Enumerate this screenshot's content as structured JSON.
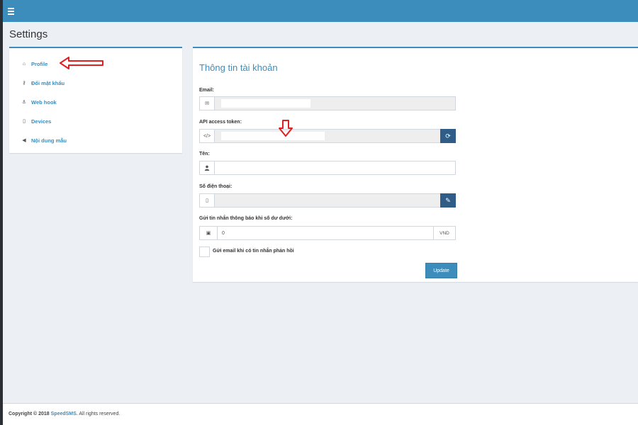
{
  "page": {
    "title": "Settings"
  },
  "sidebar": {
    "items": [
      {
        "label": "Profile",
        "icon": "home-icon",
        "glyph": "⌂"
      },
      {
        "label": "Đổi mật khẩu",
        "icon": "key-icon",
        "glyph": "⚷"
      },
      {
        "label": "Web hook",
        "icon": "anchor-icon",
        "glyph": "⚓"
      },
      {
        "label": "Devices",
        "icon": "mobile-icon",
        "glyph": "▯"
      },
      {
        "label": "Nội dung mẫu",
        "icon": "bullhorn-icon",
        "glyph": "◀"
      }
    ]
  },
  "form": {
    "title": "Thông tin tài khoản",
    "email_label": "Email:",
    "email_icon": "envelope-icon",
    "email_glyph": "✉",
    "token_label": "API access token:",
    "token_icon": "code-icon",
    "token_glyph": "</>",
    "token_refresh_icon": "refresh-icon",
    "token_refresh_glyph": "⟳",
    "name_label": "Tên:",
    "name_icon": "user-icon",
    "name_glyph": "👤",
    "phone_label": "Số điện thoại:",
    "phone_icon": "mobile-icon",
    "phone_glyph": "▯",
    "phone_edit_icon": "pencil-icon",
    "phone_edit_glyph": "✎",
    "balance_label": "Gửi tin nhắn thông báo khi số dư dưới:",
    "balance_icon": "money-icon",
    "balance_glyph": "▣",
    "balance_value": "0",
    "balance_unit": "VND",
    "email_reply_label": "Gửi email khi có tin nhắn phản hồi",
    "update_label": "Update"
  },
  "footer": {
    "prefix": "Copyright © 2018",
    "brand": "SpeedSMS.",
    "suffix": "All rights reserved."
  },
  "colors": {
    "accent": "#3c8dbc",
    "annotation_red": "#e02020",
    "dark_button": "#2f5d87"
  }
}
